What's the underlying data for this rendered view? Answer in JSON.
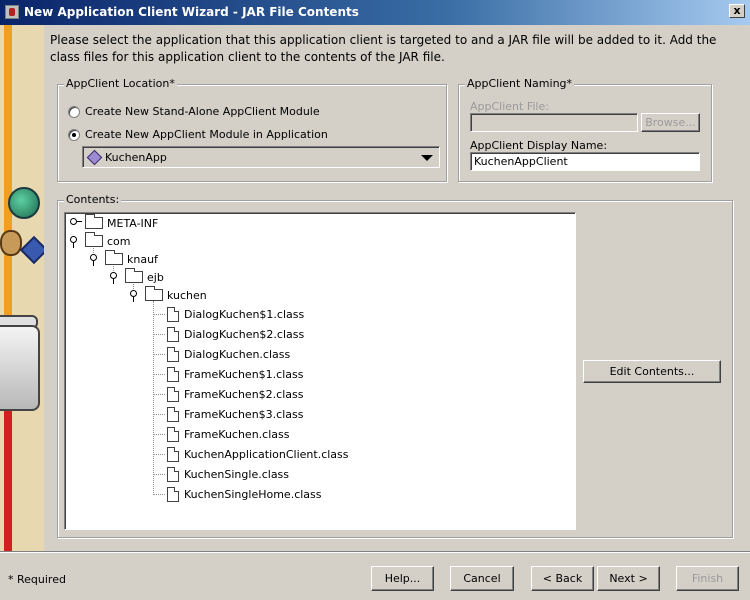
{
  "window": {
    "title": "New Application Client Wizard - JAR File Contents",
    "close_glyph": "x"
  },
  "instructions": "Please select the application that this application client is targeted to and a JAR file will be added to it.  Add the class files for this application client to the contents of the JAR file.",
  "location": {
    "legend": "AppClient Location*",
    "standalone_label": "Create New Stand-Alone AppClient Module",
    "in_app_label": "Create New AppClient Module in Application",
    "selected": "in_app",
    "application_combo": "KuchenApp"
  },
  "naming": {
    "legend": "AppClient Naming*",
    "file_label": "AppClient File:",
    "file_value": "",
    "browse_label": "Browse...",
    "display_name_label": "AppClient Display Name:",
    "display_name_value": "KuchenAppClient"
  },
  "contents": {
    "legend": "Contents:",
    "edit_button": "Edit Contents...",
    "tree": [
      {
        "label": "META-INF",
        "kind": "folder",
        "depth": 0,
        "toggle": "collapsed"
      },
      {
        "label": "com",
        "kind": "folder",
        "depth": 0,
        "toggle": "expanded"
      },
      {
        "label": "knauf",
        "kind": "folder",
        "depth": 1,
        "toggle": "expanded"
      },
      {
        "label": "ejb",
        "kind": "folder",
        "depth": 2,
        "toggle": "expanded"
      },
      {
        "label": "kuchen",
        "kind": "folder",
        "depth": 3,
        "toggle": "expanded"
      },
      {
        "label": "DialogKuchen$1.class",
        "kind": "file",
        "depth": 4
      },
      {
        "label": "DialogKuchen$2.class",
        "kind": "file",
        "depth": 4
      },
      {
        "label": "DialogKuchen.class",
        "kind": "file",
        "depth": 4
      },
      {
        "label": "FrameKuchen$1.class",
        "kind": "file",
        "depth": 4
      },
      {
        "label": "FrameKuchen$2.class",
        "kind": "file",
        "depth": 4
      },
      {
        "label": "FrameKuchen$3.class",
        "kind": "file",
        "depth": 4
      },
      {
        "label": "FrameKuchen.class",
        "kind": "file",
        "depth": 4
      },
      {
        "label": "KuchenApplicationClient.class",
        "kind": "file",
        "depth": 4
      },
      {
        "label": "KuchenSingle.class",
        "kind": "file",
        "depth": 4
      },
      {
        "label": "KuchenSingleHome.class",
        "kind": "file",
        "depth": 4
      }
    ]
  },
  "footer": {
    "required_note": "* Required",
    "help": "Help...",
    "cancel": "Cancel",
    "back": "< Back",
    "next": "Next >",
    "finish": "Finish"
  }
}
